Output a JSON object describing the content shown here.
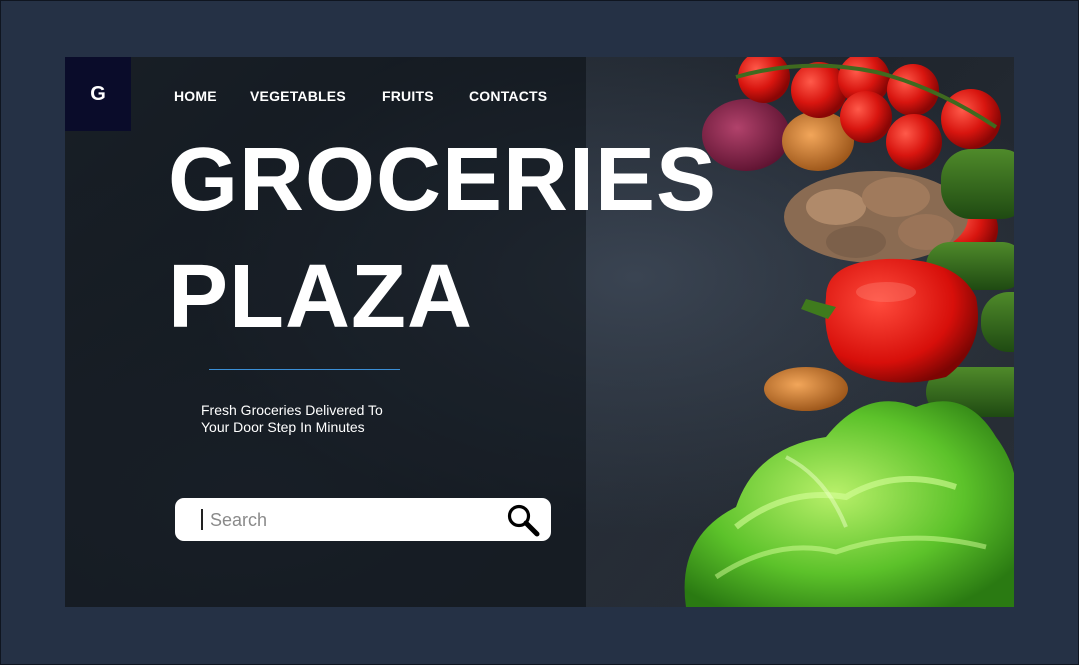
{
  "logo": {
    "letter": "G"
  },
  "nav": {
    "items": [
      {
        "label": "HOME"
      },
      {
        "label": "VEGETABLES"
      },
      {
        "label": "FRUITS"
      },
      {
        "label": "CONTACTS"
      }
    ]
  },
  "hero": {
    "title_line1": "GROCERIES",
    "title_line2": "PLAZA",
    "tagline_line1": "Fresh Groceries Delivered To",
    "tagline_line2": "Your Door Step In Minutes"
  },
  "search": {
    "placeholder": "Search"
  },
  "icons": {
    "search": "search-icon"
  },
  "colors": {
    "page_background": "#253145",
    "logo_background": "#0a0c2a",
    "divider": "#3b8fd6",
    "text": "#ffffff"
  }
}
